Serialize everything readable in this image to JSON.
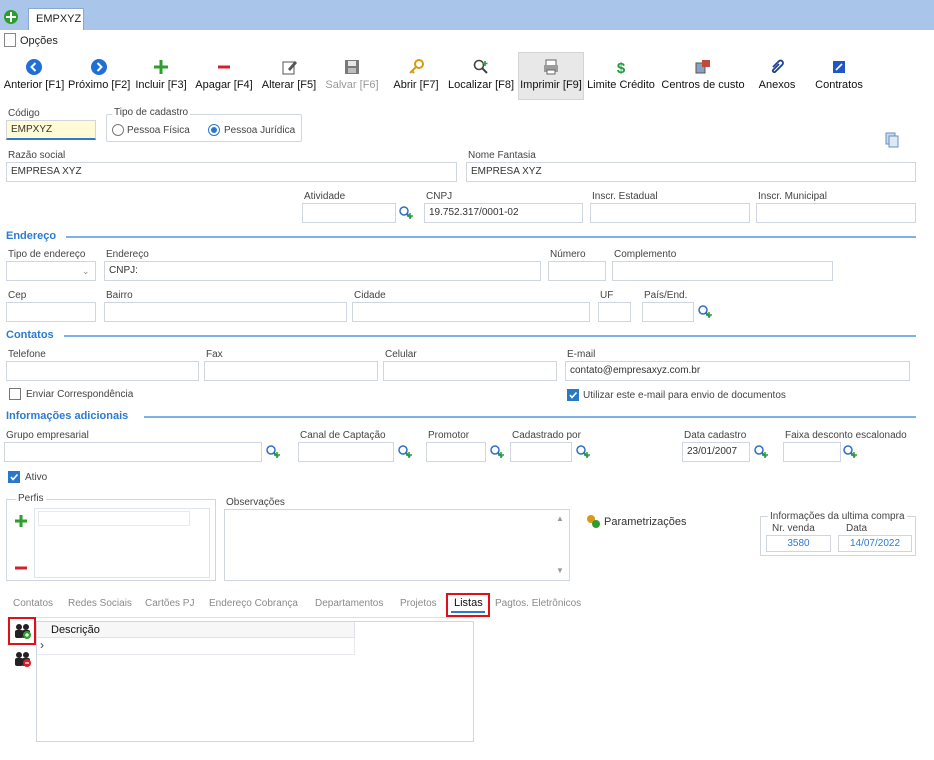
{
  "window": {
    "tab_label": "EMPXYZ",
    "menu_options": "Opções"
  },
  "toolbar": {
    "prev": "Anterior [F1]",
    "next": "Próximo [F2]",
    "add": "Incluir [F3]",
    "delete": "Apagar [F4]",
    "edit": "Alterar [F5]",
    "save": "Salvar [F6]",
    "open": "Abrir [F7]",
    "find": "Localizar [F8]",
    "print": "Imprimir [F9]",
    "credit": "Limite Crédito",
    "cost_centers": "Centros de custo",
    "attachments": "Anexos",
    "contracts": "Contratos"
  },
  "form": {
    "codigo_label": "Código",
    "codigo_value": "EMPXYZ",
    "tipo_cadastro_label": "Tipo de cadastro",
    "pessoa_fisica": "Pessoa Física",
    "pessoa_juridica": "Pessoa Jurídica",
    "razao_social_label": "Razão social",
    "razao_social_value": "EMPRESA XYZ",
    "nome_fantasia_label": "Nome Fantasia",
    "nome_fantasia_value": "EMPRESA XYZ",
    "atividade_label": "Atividade",
    "cnpj_label": "CNPJ",
    "cnpj_value": "19.752.317/0001-02",
    "inscr_estadual_label": "Inscr. Estadual",
    "inscr_municipal_label": "Inscr. Municipal"
  },
  "endereco": {
    "section": "Endereço",
    "tipo_label": "Tipo de endereço",
    "endereco_label": "Endereço",
    "endereco_value": "CNPJ:",
    "numero_label": "Número",
    "complemento_label": "Complemento",
    "cep_label": "Cep",
    "bairro_label": "Bairro",
    "cidade_label": "Cidade",
    "uf_label": "UF",
    "pais_label": "País/End."
  },
  "contatos": {
    "section": "Contatos",
    "telefone_label": "Telefone",
    "fax_label": "Fax",
    "celular_label": "Celular",
    "email_label": "E-mail",
    "email_value": "contato@empresaxyz.com.br",
    "enviar_corresp": "Enviar Correspondência",
    "utilizar_email": "Utilizar este e-mail para envio de documentos"
  },
  "info": {
    "section": "Informações adicionais",
    "grupo_label": "Grupo empresarial",
    "canal_label": "Canal de Captação",
    "promotor_label": "Promotor",
    "cadastrado_label": "Cadastrado por",
    "data_cadastro_label": "Data cadastro",
    "data_cadastro_value": "23/01/2007",
    "faixa_label": "Faixa desconto escalonado",
    "ativo_label": "Ativo",
    "perfis_label": "Perfis",
    "observacoes_label": "Observações",
    "parametrizacoes": "Parametrizações",
    "ultima_compra_label": "Informações da ultima compra",
    "nr_venda_label": "Nr. venda",
    "nr_venda_value": "3580",
    "data_label": "Data",
    "data_value": "14/07/2022"
  },
  "tabs": [
    "Contatos",
    "Redes Sociais",
    "Cartões PJ",
    "Endereço Cobrança",
    "Departamentos",
    "Projetos",
    "Listas",
    "Pagtos. Eletrônicos"
  ],
  "grid": {
    "col_descricao": "Descrição"
  },
  "colors": {
    "accent": "#2d7bd1",
    "highlight_box": "#e0101a",
    "title_bar": "#a9c6ea"
  }
}
